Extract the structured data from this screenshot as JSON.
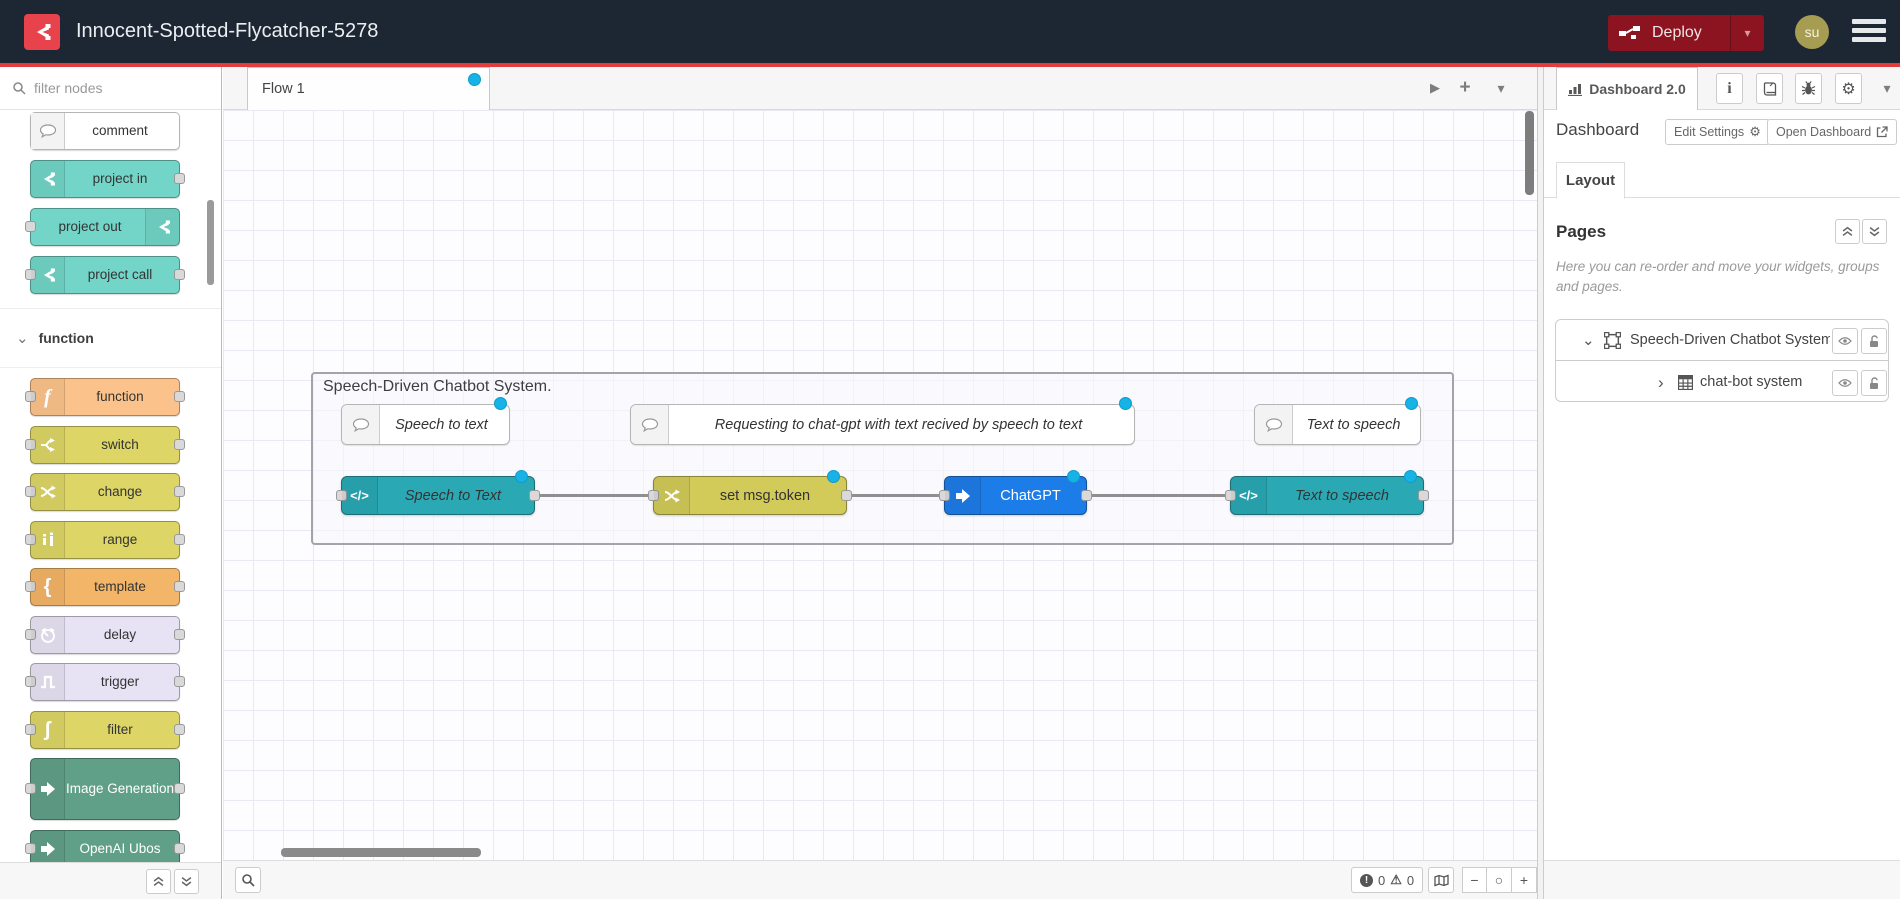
{
  "header": {
    "title": "Innocent-Spotted-Flycatcher-5278",
    "deploy_label": "Deploy",
    "avatar_text": "su"
  },
  "palette": {
    "filter_placeholder": "filter nodes",
    "category_label": "function",
    "items": [
      {
        "label": "comment"
      },
      {
        "label": "project in"
      },
      {
        "label": "project out"
      },
      {
        "label": "project call"
      },
      {
        "label": "function"
      },
      {
        "label": "switch"
      },
      {
        "label": "change"
      },
      {
        "label": "range"
      },
      {
        "label": "template"
      },
      {
        "label": "delay"
      },
      {
        "label": "trigger"
      },
      {
        "label": "filter"
      },
      {
        "label": "Image Generation"
      },
      {
        "label": "OpenAI Ubos"
      }
    ]
  },
  "canvas": {
    "tab_label": "Flow 1",
    "group_label": "Speech-Driven Chatbot System.",
    "comments": [
      {
        "label": "Speech to text"
      },
      {
        "label": "Requesting to chat-gpt with text recived by speech to text"
      },
      {
        "label": "Text to speech"
      }
    ],
    "nodes": [
      {
        "label": "Speech to Text"
      },
      {
        "label": "set msg.token"
      },
      {
        "label": "ChatGPT"
      },
      {
        "label": "Text to speech"
      }
    ]
  },
  "sidebar": {
    "tab_label": "Dashboard 2.0",
    "section_title": "Dashboard",
    "edit_settings_label": "Edit Settings",
    "open_dashboard_label": "Open Dashboard",
    "layout_tab_label": "Layout",
    "pages_title": "Pages",
    "pages_description": "Here you can re-order and move your widgets, groups and pages.",
    "tree": [
      {
        "label": "Speech-Driven Chatbot System"
      },
      {
        "label": "chat-bot system"
      }
    ]
  },
  "statusbar": {
    "error_count": "0",
    "warning_count": "0"
  },
  "icons": {
    "caret_down": "▾",
    "play_arrow": "▶",
    "plus": "+",
    "minus": "−",
    "circle": "○",
    "chevron_down": "⌄",
    "chevron_right": "›",
    "gear": "⚙",
    "info": "i",
    "function_f": "f",
    "left_bracket": "{",
    "filter_glyph": "ʃ",
    "code": "</>"
  },
  "colors": {
    "header_bg": "#1c2733",
    "accent_red": "#e23c3c",
    "deploy_red": "#8c1420",
    "avatar_olive": "#a79d52",
    "node_teal": "#2aa9b5",
    "node_yellow": "#ddd566",
    "node_canvas_yellow": "#d2cb5a",
    "node_blue": "#1d7de8",
    "node_green": "#61a088",
    "node_lavender": "#e7e3f4",
    "node_orange": "#f3b567",
    "node_peach": "#fbc38b",
    "node_project": "#72d5c8",
    "changed_dot": "#17b3e6",
    "wire": "#8f8f8f"
  }
}
